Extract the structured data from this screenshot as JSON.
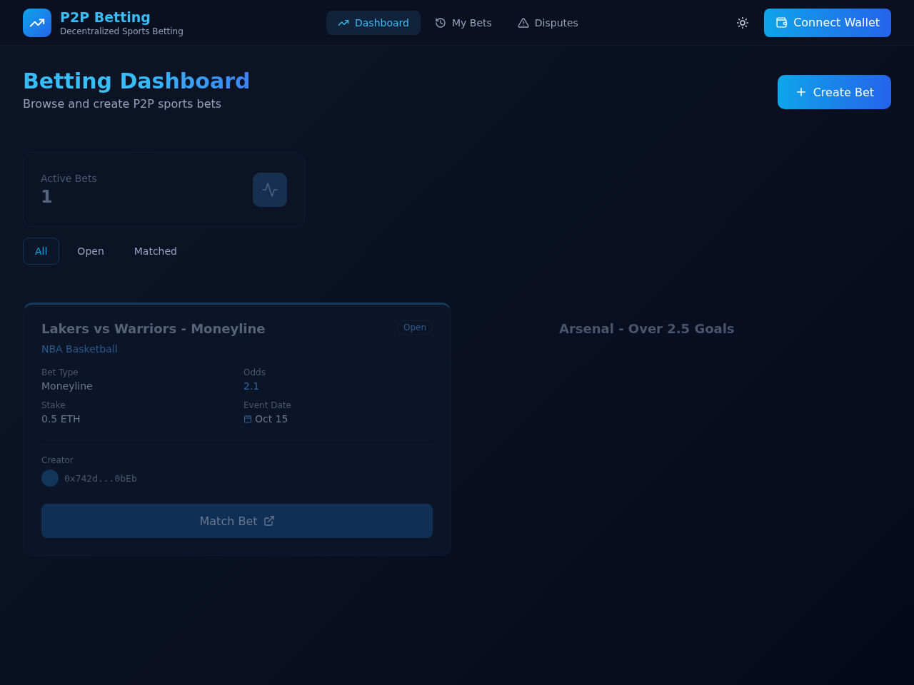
{
  "header": {
    "brand": "P2P Betting",
    "tagline": "Decentralized Sports Betting",
    "nav": [
      {
        "label": "Dashboard",
        "selected": true
      },
      {
        "label": "My Bets",
        "selected": false
      },
      {
        "label": "Disputes",
        "selected": false
      }
    ],
    "wallet_button": "Connect Wallet"
  },
  "page": {
    "title": "Betting Dashboard",
    "subtitle": "Browse and create P2P sports bets",
    "create_button": "Create Bet"
  },
  "stats": [
    {
      "label": "Active Bets",
      "value": "1"
    }
  ],
  "filters": [
    {
      "label": "All",
      "selected": true
    },
    {
      "label": "Open",
      "selected": false
    },
    {
      "label": "Matched",
      "selected": false
    }
  ],
  "bets": [
    {
      "kind": "full",
      "title": "Lakers vs Warriors - Moneyline",
      "league": "NBA Basketball",
      "status": "Open",
      "fields": [
        {
          "kind": "text",
          "label": "Bet Type",
          "value": "Moneyline"
        },
        {
          "kind": "odds",
          "label": "Odds",
          "value": "2.1"
        },
        {
          "kind": "text",
          "label": "Stake",
          "value": "0.5 ETH"
        },
        {
          "kind": "date",
          "label": "Event Date",
          "value": "Oct 15"
        }
      ],
      "creator_label": "Creator",
      "creator": "0x742d...0bEb",
      "action": "Match Bet"
    },
    {
      "kind": "fading",
      "title": "Arsenal - Over 2.5 Goals"
    }
  ]
}
